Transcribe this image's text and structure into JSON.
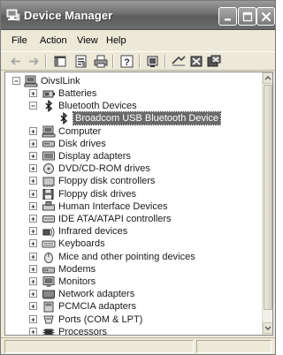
{
  "window": {
    "title": "Device Manager"
  },
  "menu": [
    "File",
    "Action",
    "View",
    "Help"
  ],
  "toolbar": [
    "back-arrow-icon",
    "forward-arrow-icon",
    "show-hide-console-tree-icon",
    "properties-icon",
    "print-icon",
    "help-icon",
    "scan-hardware-icon",
    "update-driver-icon",
    "disable-device-icon",
    "uninstall-device-icon"
  ],
  "tree": {
    "root": "OivslLink",
    "items": [
      {
        "label": "Batteries",
        "icon": "battery-icon",
        "expander": "plus"
      },
      {
        "label": "Bluetooth Devices",
        "icon": "bluetooth-icon",
        "expander": "minus"
      },
      {
        "label": "Broadcom USB Bluetooth Device",
        "icon": "bluetooth-icon",
        "child": true,
        "selected": true
      },
      {
        "label": "Computer",
        "icon": "computer-icon",
        "expander": "plus"
      },
      {
        "label": "Disk drives",
        "icon": "disk-drive-icon",
        "expander": "plus"
      },
      {
        "label": "Display adapters",
        "icon": "display-adapter-icon",
        "expander": "plus"
      },
      {
        "label": "DVD/CD-ROM drives",
        "icon": "cd-rom-icon",
        "expander": "plus"
      },
      {
        "label": "Floppy disk controllers",
        "icon": "floppy-controller-icon",
        "expander": "plus"
      },
      {
        "label": "Floppy disk drives",
        "icon": "floppy-disk-icon",
        "expander": "plus"
      },
      {
        "label": "Human Interface Devices",
        "icon": "hid-icon",
        "expander": "plus"
      },
      {
        "label": "IDE ATA/ATAPI controllers",
        "icon": "ide-controller-icon",
        "expander": "plus"
      },
      {
        "label": "Infrared devices",
        "icon": "infrared-icon",
        "expander": "plus"
      },
      {
        "label": "Keyboards",
        "icon": "keyboard-icon",
        "expander": "plus"
      },
      {
        "label": "Mice and other pointing devices",
        "icon": "mouse-icon",
        "expander": "plus"
      },
      {
        "label": "Modems",
        "icon": "modem-icon",
        "expander": "plus"
      },
      {
        "label": "Monitors",
        "icon": "monitor-icon",
        "expander": "plus"
      },
      {
        "label": "Network adapters",
        "icon": "network-adapter-icon",
        "expander": "plus"
      },
      {
        "label": "PCMCIA adapters",
        "icon": "pcmcia-icon",
        "expander": "plus"
      },
      {
        "label": "Ports (COM & LPT)",
        "icon": "port-icon",
        "expander": "plus"
      },
      {
        "label": "Processors",
        "icon": "processor-icon",
        "expander": "plus"
      }
    ]
  }
}
